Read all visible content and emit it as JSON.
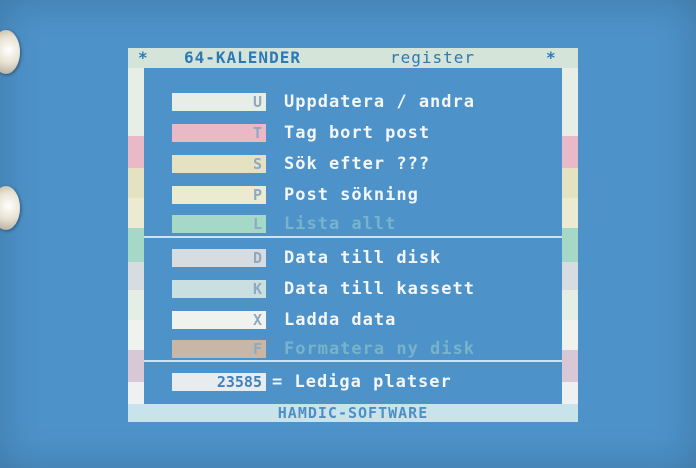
{
  "header": {
    "star_left": "*",
    "title": "64-KALENDER",
    "subtitle": "register",
    "star_right": "*"
  },
  "menu": [
    {
      "key": "U",
      "label": "Uppdatera / andra",
      "color": "#e7eee6"
    },
    {
      "key": "T",
      "label": "Tag bort post",
      "color": "#e9b9c8"
    },
    {
      "key": "S",
      "label": "Sök efter ???",
      "color": "#e4e2c0"
    },
    {
      "key": "P",
      "label": "Post sökning",
      "color": "#ecebd2"
    },
    {
      "key": "L",
      "label": "Lista allt",
      "color": "#a6d8c8"
    },
    {
      "key": "D",
      "label": "Data till disk",
      "color": "#d6dce0"
    },
    {
      "key": "K",
      "label": "Data till kassett",
      "color": "#c9dfe0"
    },
    {
      "key": "X",
      "label": "Ladda data",
      "color": "#f0f2ee"
    },
    {
      "key": "F",
      "label": "Formatera ny disk",
      "color": "#c8b7a6"
    }
  ],
  "status": {
    "free_count": "23585",
    "free_label": "= Lediga platser"
  },
  "footer": {
    "text": "HAMDIC-SOFTWARE"
  },
  "colors": {
    "screen_background": "#4d92c9",
    "text": "#f4f6f8"
  }
}
